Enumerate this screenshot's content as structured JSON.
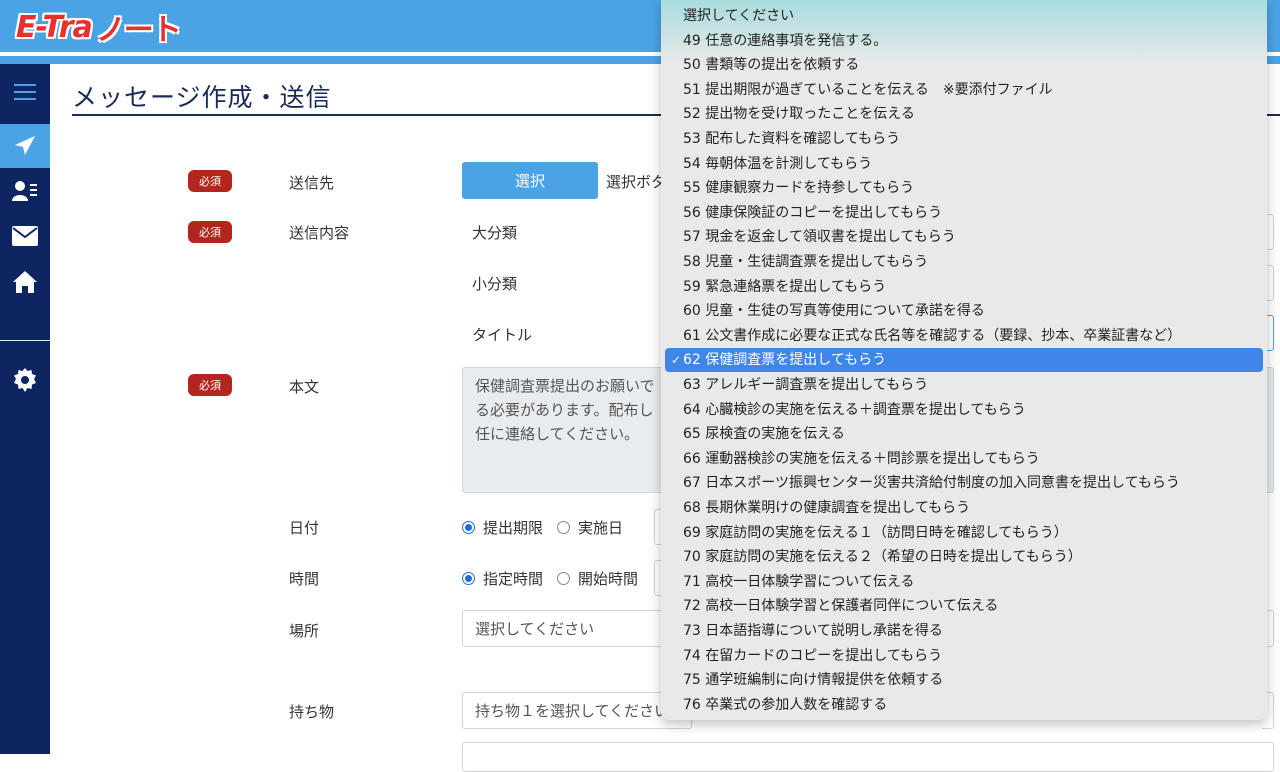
{
  "brand": {
    "part1": "E-Tra",
    "part2": "ノート"
  },
  "sidebar": {
    "items": [
      {
        "name": "menu-icon",
        "glyph": "☰"
      },
      {
        "name": "send-icon",
        "glyph": "➤"
      },
      {
        "name": "contacts-icon",
        "glyph": "👤"
      },
      {
        "name": "mail-icon",
        "glyph": "✉"
      },
      {
        "name": "home-icon",
        "glyph": "⌂"
      },
      {
        "name": "gear-icon",
        "glyph": "⚙"
      }
    ]
  },
  "page": {
    "title": "メッセージ作成・送信"
  },
  "form": {
    "required_badge": "必須",
    "recipient_label": "送信先",
    "select_button": "選択",
    "select_hint": "選択ボタ",
    "content_label": "送信内容",
    "major_category_label": "大分類",
    "minor_category_label": "小分類",
    "title_label": "タイトル",
    "body_label": "本文",
    "body_text_1": "保健調査票提出のお願いで",
    "body_text_2": "る必要があります。配布し",
    "body_text_3": "任に連絡してください。",
    "date_label": "日付",
    "date_option_1": "提出期限",
    "date_option_2": "実施日",
    "time_label": "時間",
    "time_option_1": "指定時間",
    "time_option_2": "開始時間",
    "place_label": "場所",
    "place_placeholder": "選択してください",
    "items_label": "持ち物",
    "items_placeholder": "持ち物１を選択してください"
  },
  "dropdown": {
    "selected_index": 14,
    "options": [
      "選択してください",
      "49 任意の連絡事項を発信する。",
      "50 書類等の提出を依頼する",
      "51 提出期限が過ぎていることを伝える　※要添付ファイル",
      "52 提出物を受け取ったことを伝える",
      "53 配布した資料を確認してもらう",
      "54 毎朝体温を計測してもらう",
      "55 健康観察カードを持参してもらう",
      "56 健康保険証のコピーを提出してもらう",
      "57 現金を返金して領収書を提出してもらう",
      "58 児童・生徒調査票を提出してもらう",
      "59 緊急連絡票を提出してもらう",
      "60 児童・生徒の写真等使用について承諾を得る",
      "61 公文書作成に必要な正式な氏名等を確認する（要録、抄本、卒業証書など）",
      "62 保健調査票を提出してもらう",
      "63 アレルギー調査票を提出してもらう",
      "64 心臓検診の実施を伝える＋調査票を提出してもらう",
      "65 尿検査の実施を伝える",
      "66 運動器検診の実施を伝える＋問診票を提出してもらう",
      "67 日本スポーツ振興センター災害共済給付制度の加入同意書を提出してもらう",
      "68 長期休業明けの健康調査を提出してもらう",
      "69 家庭訪問の実施を伝える１（訪問日時を確認してもらう）",
      "70 家庭訪問の実施を伝える２（希望の日時を提出してもらう）",
      "71 高校一日体験学習について伝える",
      "72 高校一日体験学習と保護者同伴について伝える",
      "73 日本語指導について説明し承諾を得る",
      "74 在留カードのコピーを提出してもらう",
      "75 通学班編制に向け情報提供を依頼する",
      "76 卒業式の参加人数を確認する"
    ]
  },
  "colors": {
    "header": "#4aa3e4",
    "sidebar": "#0f2561",
    "badge": "#b3261e",
    "selected_option": "#3f86e8"
  }
}
